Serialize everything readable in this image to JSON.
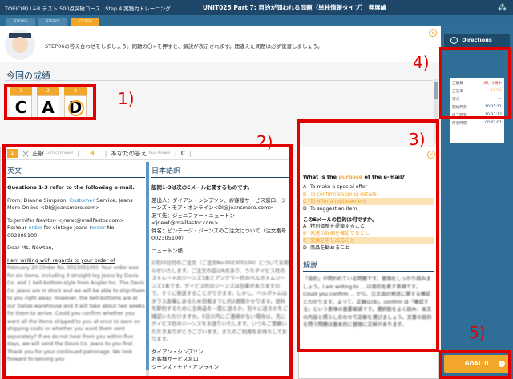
{
  "header": {
    "course": "TOEIC(R) L&R テスト 500点突破コース",
    "part": "Step 4 実践力トレーニング",
    "title": "UNIT025 Part 7: 目的が問われる問題（単独情報タイプ） 発展編"
  },
  "tabs": [
    "STEP05",
    "STEP05",
    "STEP06"
  ],
  "instruction": "STEP06の答え合わせをしましょう。問題の〇×を押すと、解説が表示されます。間違えた問題は必ず復習しましょう。",
  "results": {
    "title": "今回の成績",
    "answers": [
      {
        "num": "1",
        "letter": "C",
        "correct": false
      },
      {
        "num": "2",
        "letter": "A",
        "correct": false
      },
      {
        "num": "3",
        "letter": "D",
        "correct": true
      }
    ]
  },
  "answer_bar": {
    "q_num": "1",
    "correct_label": "正解",
    "correct_en": "Correct Answer",
    "correct_choice": "B",
    "yours_label": "あなたの答え",
    "yours_en": "Your Answer",
    "yours_choice": "C"
  },
  "english": {
    "heading": "英文",
    "intro": "Questions 1-3 refer to the following e-mail.",
    "from_a": "From: Dianne Simpson, ",
    "from_b": "Customer",
    "from_c": " Service, Jeans More Online <DI@jeansmore.com>",
    "to": "To:Jennifer Newton <jnewt@mailfastor.com>",
    "re_a": "Re:Your ",
    "re_b": "order",
    "re_c": " for vintage jeans (",
    "re_d": "order",
    "re_e": " No. 002305100)",
    "greeting": "Dear Ms. Newton,",
    "body_u": "I am writing with regards to your order of",
    "body_rest": "February 20 (Order No. 002305100). Your order was for six items, including 3 straight leg jeans by Davis Co. and 1 bell-bottom style from Angler Inc. The Davis Co. jeans are in stock and we will be able to ship them to you right away. However, the bell-bottoms are at our Dallas warehouse and it will take about two weeks for them to arrive. Could you confirm whether you want all the items shipped to you at once to save on shipping costs or whether you want them sent separately? If we do not hear from you within five days, we will send the Davis Co. jeans to you first. Thank you for your continued patronage. We look forward to serving you"
  },
  "japanese": {
    "heading": "日本語訳",
    "intro": "設問1-3は次のEメールに関するものです。",
    "from": "差出人：ダイアン・シンプソン、お客様サービス窓口、ジーンズ・モア・オンライン<DI@jeansmore.com>",
    "to": "あて先：ジェニファー・ニュートン<jnewt@mailfastor.com>",
    "re": "件名：ビンテージ・ジーンズのご注文について（注文番号002305100）",
    "greeting": "ニュートン様",
    "body": "2月20日付のご注文（ご注文No.002305100）についてお知らせいたします。ご注文の品は6点あり、うちデイビス社のストレートのジーンズ3本とアングラー社のベルボトムジーンズ1本です。デイビス社のジーンズは在庫がありますので、すぐに発送することができます。しかし、ベルボトムはダラス倉庫にあるため到着までに約2週間かかります。送料を節約するために全商品を一度に送るか、別々に送るかをご確認いただけますか。5日以内にご連絡がない場合は、先にデイビス社のジーンズをお送りいたします。いつもご愛顧いただきありがとうございます。またのご利用をお待ちしております。",
    "sign1": "ダイアン・シンプソン",
    "sign2": "お客様サービス窓口",
    "sign3": "ジーンズ・モア・オンライン"
  },
  "question": {
    "text_a": "What is the ",
    "text_b": "purpose",
    "text_c": " of the e-mail?",
    "options": [
      {
        "key": "A",
        "text": "To make a special offer"
      },
      {
        "key": "B",
        "text": "To confirm shipping details"
      },
      {
        "key": "C",
        "text": "To offer a replacement"
      },
      {
        "key": "D",
        "text": "To suggest an item"
      }
    ],
    "jp_question": "このEメールの目的は何ですか。",
    "jp_options": [
      {
        "key": "A",
        "text": "特別価格を提案すること"
      },
      {
        "key": "B",
        "text": "発送の詳細を確認すること"
      },
      {
        "key": "C",
        "text": "交換を申し出ること"
      },
      {
        "key": "D",
        "text": "商品を勧めること"
      }
    ],
    "kaisetsu_heading": "解説",
    "kaisetsu": "「目的」が問われている問題です。冒頭をしっかり読みましょう。I am writing to ... は目的を表す表現です。Could you confirm ... から、注文品の発送に関する確認とわかります。よって、正解は(B)。confirm は「確認する」という意味の重要単語です。選択肢をよく読み、本文の内容と照らし合わせて正解を選びましょう。文書の目的を問う問題は基本的に冒頭に正解があります。"
  },
  "markers": [
    "1)",
    "2)",
    "3)",
    "4)",
    "5)"
  ],
  "sidebar": {
    "directions": "Directions",
    "stats": [
      {
        "label": "正解数",
        "value": "1問／3問中"
      },
      {
        "label": "正答率",
        "value": "33.3%"
      },
      {
        "label": "得点",
        "value": "--"
      },
      {
        "label": "開始時刻",
        "value": "10:35:11"
      },
      {
        "label": "終了時刻",
        "value": "10:37:12"
      },
      {
        "label": "所要時間",
        "value": "00:02:01"
      }
    ],
    "goal": "GOAL !!"
  },
  "colors": {
    "accent": "#f2a62a",
    "navy": "#1e4668",
    "sidebar": "#2f6f97",
    "marker": "#e00000"
  }
}
